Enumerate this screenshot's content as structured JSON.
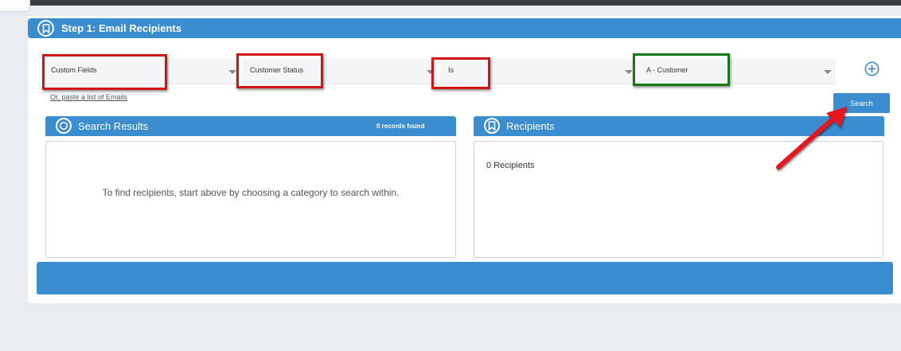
{
  "step": {
    "title": "Step 1: Email Recipients",
    "icon": "bookmark-icon"
  },
  "filters": {
    "category": {
      "value": "Custom Fields"
    },
    "field": {
      "value": "Customer Status"
    },
    "operator": {
      "value": "Is"
    },
    "value": {
      "value": "A - Customer"
    }
  },
  "paste_link": "Or, paste a list of Emails",
  "add_filter_icon": "plus-circle-icon",
  "search_button": "Search",
  "search_results": {
    "title": "Search Results",
    "count_label": "0 records found",
    "empty_message": "To find recipients, start above by choosing a category to search within."
  },
  "recipients": {
    "title": "Recipients",
    "count_label": "0 Recipients"
  },
  "annotations": {
    "red_box_color": "#d41414",
    "green_box_color": "#157a15",
    "arrow_color": "#e8141a"
  },
  "colors": {
    "accent": "#3a8dcf",
    "top_bar": "#3a3d42",
    "page_bg": "#e9edf1"
  }
}
